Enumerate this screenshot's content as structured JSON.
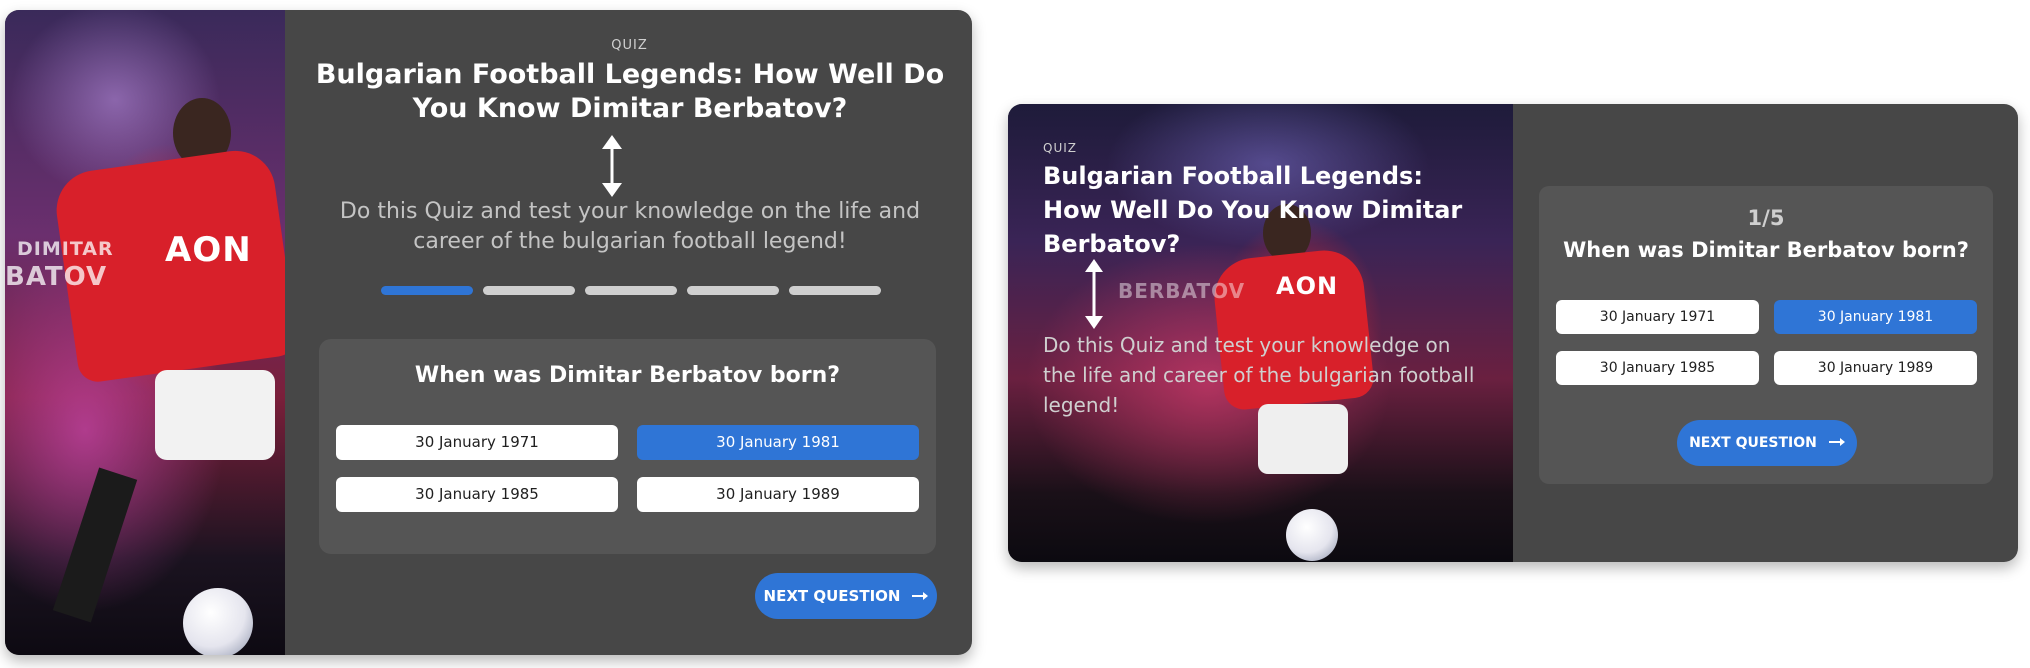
{
  "quiz_label": "QUIZ",
  "title": "Bulgarian Football Legends: How Well Do You Know Dimitar Berbatov?",
  "description": "Do this Quiz and test your knowledge on the life and career of the bulgarian football legend!",
  "progress": {
    "current": 1,
    "total": 5,
    "counter_text": "1/5"
  },
  "question": "When was Dimitar Berbatov born?",
  "answers": [
    {
      "label": "30 January 1971",
      "selected": false
    },
    {
      "label": "30 January 1981",
      "selected": true
    },
    {
      "label": "30 January 1985",
      "selected": false
    },
    {
      "label": "30 January 1989",
      "selected": false
    }
  ],
  "next_button": {
    "label": "NEXT QUESTION",
    "icon": "arrow-right-icon"
  },
  "photo_overlay": {
    "line1": "DIMITAR",
    "line2": "BATOV",
    "line3": "BERBATOV",
    "sponsor": "AON"
  },
  "colors": {
    "accent": "#2f75d6",
    "card": "#474747",
    "panel": "#555555"
  }
}
